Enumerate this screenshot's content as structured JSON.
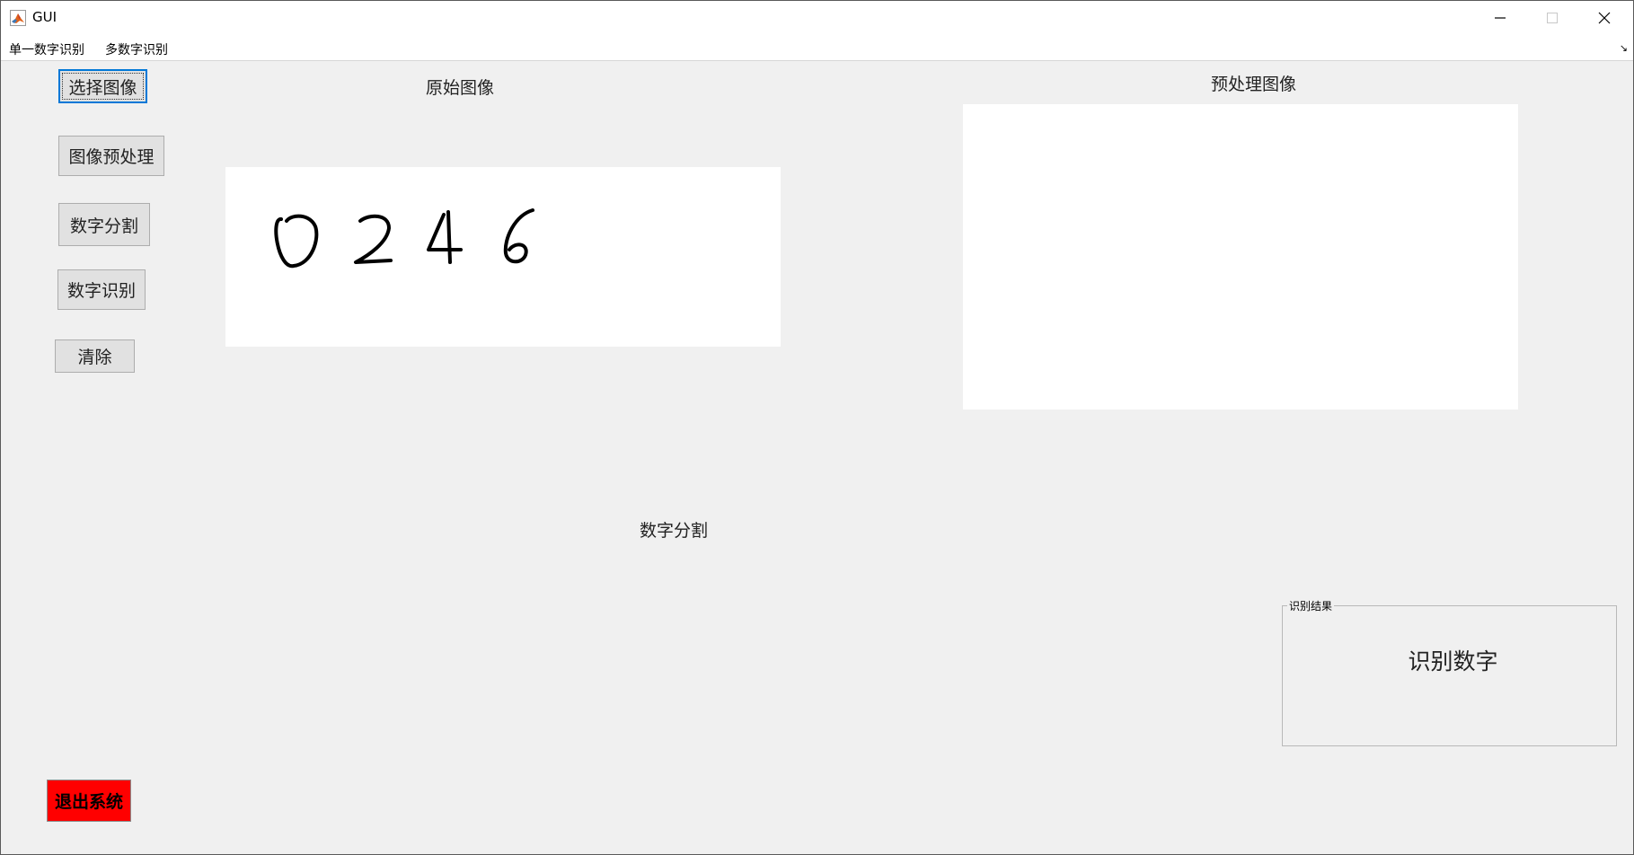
{
  "window": {
    "title": "GUI"
  },
  "menubar": {
    "items": [
      {
        "label": "单一数字识别"
      },
      {
        "label": "多数字识别"
      }
    ],
    "corner_glyph": "↘"
  },
  "buttons": {
    "select_image": "选择图像",
    "preprocess": "图像预处理",
    "segment": "数字分割",
    "recognize": "数字识别",
    "clear": "清除",
    "exit": "退出系统"
  },
  "labels": {
    "original_image": "原始图像",
    "preprocessed_image": "预处理图像",
    "digit_segmentation": "数字分割"
  },
  "result_panel": {
    "title": "识别结果",
    "value": "识别数字"
  },
  "original_image": {
    "handwritten_digits": "0246"
  },
  "colors": {
    "window_bg": "#f0f0f0",
    "exit_button_bg": "#ff0000",
    "button_bg": "#e1e1e1",
    "focus_accent": "#0078d7"
  },
  "icons": {
    "app": "matlab-logo-icon",
    "minimize": "minimize-icon",
    "maximize": "maximize-icon",
    "close": "close-icon"
  }
}
